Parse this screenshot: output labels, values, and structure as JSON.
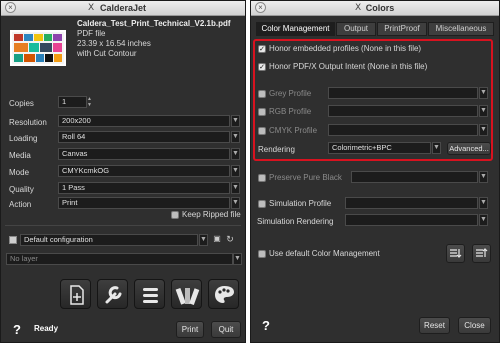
{
  "left_window": {
    "title": "CalderaJet",
    "file": {
      "name": "Caldera_Test_Print_Technical_V2.1b.pdf",
      "type": "PDF file",
      "size": "23.39 x 16.54 inches",
      "note": "with Cut Contour"
    },
    "fields": {
      "copies_label": "Copies",
      "copies_value": "1",
      "resolution_label": "Resolution",
      "resolution_value": "200x200",
      "loading_label": "Loading",
      "loading_value": "Roll 64",
      "media_label": "Media",
      "media_value": "Canvas",
      "mode_label": "Mode",
      "mode_value": "CMYKcmkOG",
      "quality_label": "Quality",
      "quality_value": "1 Pass",
      "action_label": "Action",
      "action_value": "Print"
    },
    "keep_ripped_label": "Keep Ripped file",
    "configuration": "Default configuration",
    "layer_placeholder": "No layer",
    "status": "Ready",
    "print_label": "Print",
    "quit_label": "Quit",
    "help": "?"
  },
  "right_window": {
    "title": "Colors",
    "tabs": [
      "Color Management",
      "Output",
      "PrintProof",
      "Miscellaneous"
    ],
    "honor_embedded_label": "Honor embedded profiles (None in this file)",
    "honor_output_label": "Honor PDF/X Output Intent (None in this file)",
    "grey_profile_label": "Grey Profile",
    "rgb_profile_label": "RGB Profile",
    "cmyk_profile_label": "CMYK Profile",
    "rendering_label": "Rendering",
    "rendering_value": "Colorimetric+BPC",
    "advanced_label": "Advanced...",
    "preserve_black_label": "Preserve Pure Black",
    "simulation_profile_label": "Simulation Profile",
    "simulation_rendering_label": "Simulation Rendering",
    "use_default_label": "Use default Color Management",
    "reset_label": "Reset",
    "close_label": "Close",
    "help": "?",
    "highlight_color": "#d8121f"
  }
}
